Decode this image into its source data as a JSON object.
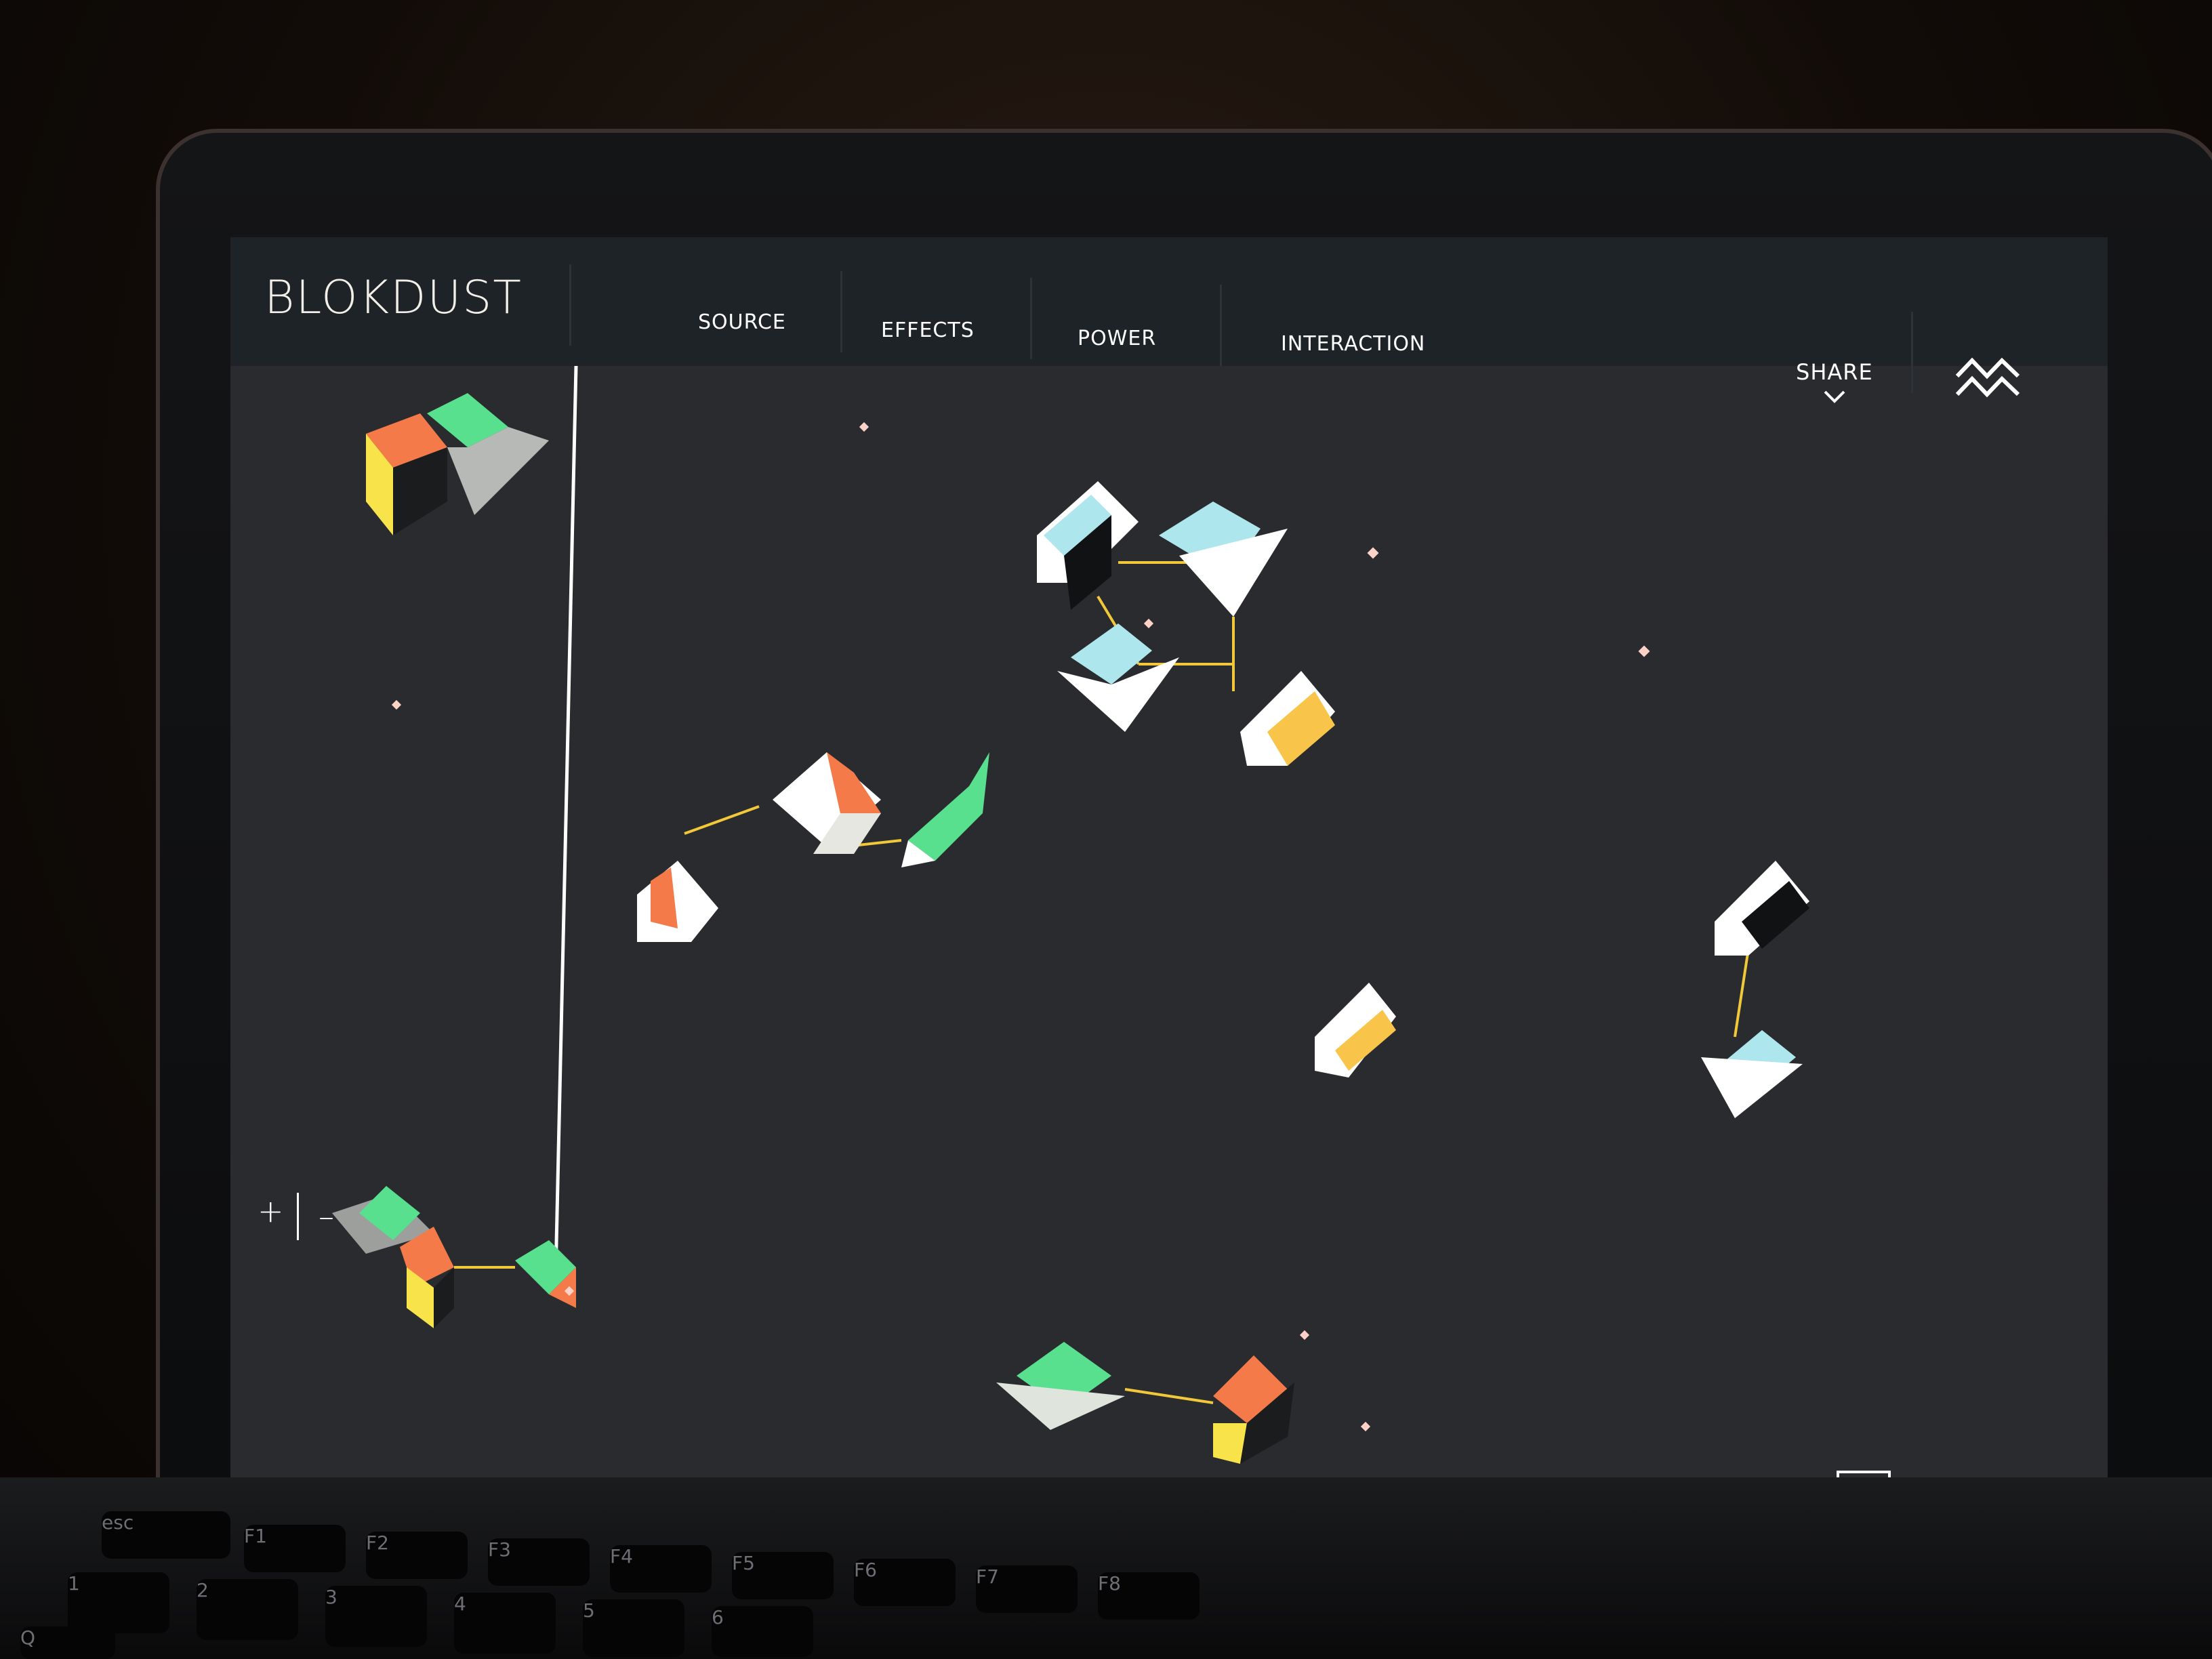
{
  "app": {
    "title": "BLOKDUST"
  },
  "nav": {
    "items": [
      {
        "label": "SOURCE"
      },
      {
        "label": "EFFECTS"
      },
      {
        "label": "POWER"
      },
      {
        "label": "INTERACTION"
      }
    ],
    "share_label": "SHARE"
  },
  "zoom": {
    "plus_label": "+",
    "minus_label": "–"
  },
  "icons": {
    "share_chevron": "chevron-down-icon",
    "waveform_toggle": "waveform-icon",
    "close": "close-icon"
  },
  "keyboard": {
    "visible_keys": [
      "esc",
      "F1",
      "F2",
      "F3",
      "F4",
      "F5",
      "F6",
      "F7",
      "F8",
      "1",
      "2",
      "3",
      "4",
      "5",
      "6",
      "Q"
    ]
  },
  "colors": {
    "screen_bg": "#2a2b2e",
    "topbar_bg": "#1d2326",
    "accent_green": "#58e08f",
    "accent_orange": "#f47a4a",
    "accent_yellow": "#f8e34a",
    "accent_cyan": "#aee6ee",
    "connector": "#f1c83a",
    "particle": "#ffd2c7"
  }
}
